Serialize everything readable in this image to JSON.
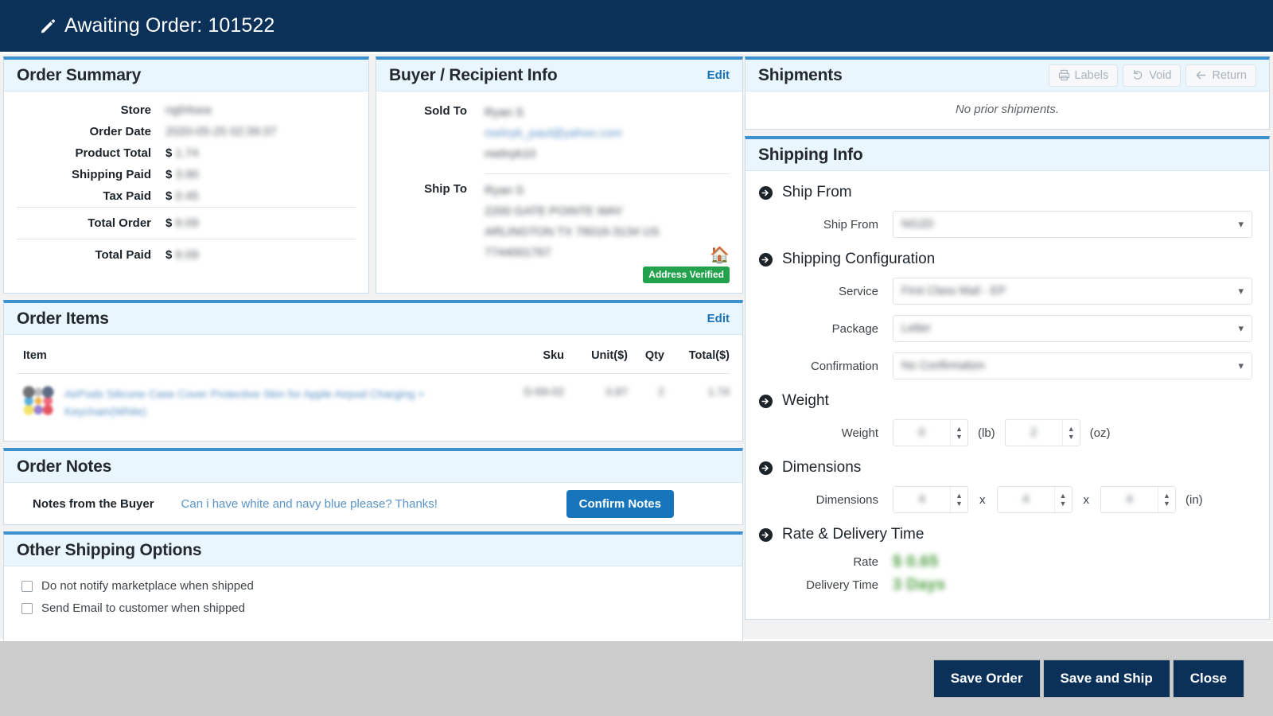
{
  "titlebar": {
    "icon": "pencil-icon",
    "title": "Awaiting Order: 101522"
  },
  "order_summary": {
    "heading": "Order Summary",
    "rows": [
      {
        "label": "Store",
        "prefix": "",
        "value": "ng04sea"
      },
      {
        "label": "Order Date",
        "prefix": "",
        "value": "2020-05-25 02:39:37"
      },
      {
        "label": "Product Total",
        "prefix": "$",
        "value": "1.74"
      },
      {
        "label": "Shipping Paid",
        "prefix": "$",
        "value": "3.90"
      },
      {
        "label": "Tax Paid",
        "prefix": "$",
        "value": "0.45"
      },
      {
        "label": "Total Order",
        "prefix": "$",
        "value": "6.09"
      },
      {
        "label": "Total Paid",
        "prefix": "$",
        "value": "6.09"
      }
    ]
  },
  "buyer": {
    "heading": "Buyer / Recipient Info",
    "edit_label": "Edit",
    "sold_to_label": "Sold To",
    "sold_to": [
      "Ryan S",
      "melnyk_paul@yahoo.com",
      "melnyk10"
    ],
    "ship_to_label": "Ship To",
    "ship_to": [
      "Ryan S",
      "2200 GATE POINTE WAY",
      "ARLINGTON TX 76016-3134 US",
      "7744001767"
    ],
    "home_icon": "home-icon",
    "verified_badge": "Address Verified"
  },
  "order_items": {
    "heading": "Order Items",
    "edit_label": "Edit",
    "columns": [
      "Item",
      "Sku",
      "Unit($)",
      "Qty",
      "Total($)"
    ],
    "rows": [
      {
        "thumbnail": "product-thumbnail",
        "name": "AirPods Silicone Case Cover Protective Skin for Apple Airpod Charging + Keychain(White)",
        "sku": "D-69-02",
        "unit": "0.87",
        "qty": "2",
        "total": "1.74"
      }
    ]
  },
  "order_notes": {
    "heading": "Order Notes",
    "label": "Notes from the Buyer",
    "text": "Can i have white and navy blue please? Thanks!",
    "confirm_label": "Confirm Notes"
  },
  "other_shipping": {
    "heading": "Other Shipping Options",
    "options": [
      {
        "label": "Do not notify marketplace when shipped",
        "checked": false
      },
      {
        "label": "Send Email to customer when shipped",
        "checked": false
      }
    ]
  },
  "shipments": {
    "heading": "Shipments",
    "buttons": [
      {
        "label": "Labels",
        "icon": "printer-icon"
      },
      {
        "label": "Void",
        "icon": "undo-icon"
      },
      {
        "label": "Return",
        "icon": "arrow-left-icon"
      }
    ],
    "empty_text": "No prior shipments."
  },
  "shipping_info": {
    "heading": "Shipping Info",
    "sections": {
      "ship_from": {
        "title": "Ship From",
        "field_label": "Ship From",
        "value": "NG2D"
      },
      "shipping_config": {
        "title": "Shipping Configuration",
        "fields": [
          {
            "label": "Service",
            "value": "First Class Mail - EP"
          },
          {
            "label": "Package",
            "value": "Letter"
          },
          {
            "label": "Confirmation",
            "value": "No Confirmation"
          }
        ]
      },
      "weight": {
        "title": "Weight",
        "field_label": "Weight",
        "lb_value": "0",
        "lb_unit": "(lb)",
        "oz_value": "2",
        "oz_unit": "(oz)"
      },
      "dimensions": {
        "title": "Dimensions",
        "field_label": "Dimensions",
        "length": "4",
        "width": "4",
        "height": "4",
        "separator": "x",
        "unit": "(in)"
      },
      "rate": {
        "title": "Rate & Delivery Time",
        "rate_label": "Rate",
        "rate_value": "$ 0.65",
        "delivery_label": "Delivery Time",
        "delivery_value": "3 Days"
      }
    }
  },
  "footer": {
    "buttons": [
      "Save Order",
      "Save and Ship",
      "Close"
    ]
  },
  "colors": {
    "title_bar": "#0b3159",
    "panel_accent": "#3d91cf",
    "panel_head_bg": "#eaf6fd",
    "link": "#1a73b8",
    "primary_button": "#1675bb",
    "verified_green": "#23a24d",
    "rate_green": "#4f9f43",
    "footer_bg": "#cccccc"
  }
}
